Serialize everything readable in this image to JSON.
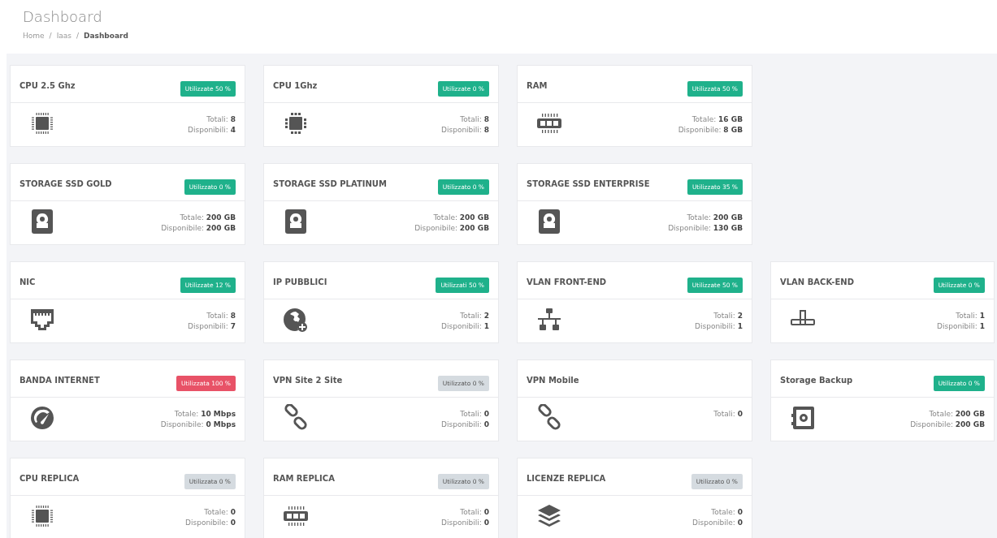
{
  "page_title": "Dashboard",
  "breadcrumb": [
    {
      "text": "Home",
      "kind": "link"
    },
    {
      "text": "/",
      "kind": "separator"
    },
    {
      "text": "Iaas",
      "kind": "link"
    },
    {
      "text": "/",
      "kind": "separator"
    },
    {
      "text": "Dashboard",
      "kind": "current"
    }
  ],
  "rows": [
    {
      "cards": [
        {
          "title": "CPU 2.5 Ghz",
          "badge": {
            "text": "Utilizzate 50 %",
            "color": "#1fb18b"
          },
          "kind": "cpu",
          "stats": [
            {
              "label": "Totali:",
              "value": "8"
            },
            {
              "label": "Disponibili:",
              "value": "4"
            }
          ]
        },
        {
          "title": "CPU 1Ghz",
          "badge": {
            "text": "Utilizzate 0 %",
            "color": "#1fb18b"
          },
          "kind": "cpu-large",
          "stats": [
            {
              "label": "Totali:",
              "value": "8"
            },
            {
              "label": "Disponibili:",
              "value": "8"
            }
          ]
        },
        {
          "title": "RAM",
          "badge": {
            "text": "Utilizzata 50 %",
            "color": "#1fb18b"
          },
          "kind": "ram",
          "stats": [
            {
              "label": "Totale:",
              "value": "16 GB"
            },
            {
              "label": "Disponibile:",
              "value": "8 GB"
            }
          ]
        }
      ]
    },
    {
      "cards": [
        {
          "title": "STORAGE SSD GOLD",
          "badge": {
            "text": "Utilizzato 0 %",
            "color": "#1fb18b"
          },
          "kind": "disk",
          "stats": [
            {
              "label": "Totale:",
              "value": "200 GB"
            },
            {
              "label": "Disponibile:",
              "value": "200 GB"
            }
          ]
        },
        {
          "title": "STORAGE SSD PLATINUM",
          "badge": {
            "text": "Utilizzato 0 %",
            "color": "#1fb18b"
          },
          "kind": "disk",
          "stats": [
            {
              "label": "Totale:",
              "value": "200 GB"
            },
            {
              "label": "Disponibile:",
              "value": "200 GB"
            }
          ]
        },
        {
          "title": "STORAGE SSD ENTERPRISE",
          "badge": {
            "text": "Utilizzato 35 %",
            "color": "#1fb18b"
          },
          "kind": "disk",
          "stats": [
            {
              "label": "Totale:",
              "value": "200 GB"
            },
            {
              "label": "Disponibile:",
              "value": "130 GB"
            }
          ]
        }
      ]
    },
    {
      "cards": [
        {
          "title": "NIC",
          "badge": {
            "text": "Utilizzate 12 %",
            "color": "#1fb18b"
          },
          "kind": "ethernet",
          "stats": [
            {
              "label": "Totali:",
              "value": "8"
            },
            {
              "label": "Disponibili:",
              "value": "7"
            }
          ]
        },
        {
          "title": "IP PUBBLICI",
          "badge": {
            "text": "Utilizzati 50 %",
            "color": "#1fb18b"
          },
          "kind": "globe-plus",
          "stats": [
            {
              "label": "Totali:",
              "value": "2"
            },
            {
              "label": "Disponibili:",
              "value": "1"
            }
          ]
        },
        {
          "title": "VLAN FRONT-END",
          "badge": {
            "text": "Utilizzate 50 %",
            "color": "#1fb18b"
          },
          "kind": "network",
          "stats": [
            {
              "label": "Totali:",
              "value": "2"
            },
            {
              "label": "Disponibili:",
              "value": "1"
            }
          ]
        },
        {
          "title": "VLAN BACK-END",
          "badge": {
            "text": "Utilizzate 0 %",
            "color": "#1fb18b"
          },
          "kind": "pipe",
          "stats": [
            {
              "label": "Totali:",
              "value": "1"
            },
            {
              "label": "Disponibili:",
              "value": "1"
            }
          ]
        }
      ]
    },
    {
      "cards": [
        {
          "title": "BANDA INTERNET",
          "badge": {
            "text": "Utilizzata 100 %",
            "color": "#e85267"
          },
          "kind": "gauge",
          "stats": [
            {
              "label": "Totale:",
              "value": "10 Mbps"
            },
            {
              "label": "Disponibile:",
              "value": "0 Mbps"
            }
          ]
        },
        {
          "title": "VPN Site 2 Site",
          "badge": {
            "text": "Utilizzato 0 %",
            "color": "#d5dbe0"
          },
          "kind": "link",
          "stats": [
            {
              "label": "Totali:",
              "value": "0"
            },
            {
              "label": "Disponibili:",
              "value": "0"
            }
          ]
        },
        {
          "title": "VPN Mobile",
          "kind": "link",
          "stats": [
            {
              "label": "Totali:",
              "value": "0"
            }
          ]
        },
        {
          "title": "Storage Backup",
          "badge": {
            "text": "Utilizzato 0 %",
            "color": "#1fb18b"
          },
          "kind": "safe",
          "stats": [
            {
              "label": "Totale:",
              "value": "200 GB"
            },
            {
              "label": "Disponibile:",
              "value": "200 GB"
            }
          ]
        }
      ]
    },
    {
      "cards": [
        {
          "title": "CPU REPLICA",
          "badge": {
            "text": "Utilizzata 0 %",
            "color": "#d5dbe0"
          },
          "kind": "cpu",
          "stats": [
            {
              "label": "Totale:",
              "value": "0"
            },
            {
              "label": "Disponibile:",
              "value": "0"
            }
          ]
        },
        {
          "title": "RAM REPLICA",
          "badge": {
            "text": "Utilizzato 0 %",
            "color": "#d5dbe0"
          },
          "kind": "ram",
          "stats": [
            {
              "label": "Totali:",
              "value": "0"
            },
            {
              "label": "Disponibili:",
              "value": "0"
            }
          ]
        },
        {
          "title": "LICENZE REPLICA",
          "badge": {
            "text": "Utilizzato 0 %",
            "color": "#d5dbe0"
          },
          "kind": "layers",
          "stats": [
            {
              "label": "Totale:",
              "value": "0"
            },
            {
              "label": "Disponibile:",
              "value": "0"
            }
          ]
        }
      ]
    }
  ]
}
